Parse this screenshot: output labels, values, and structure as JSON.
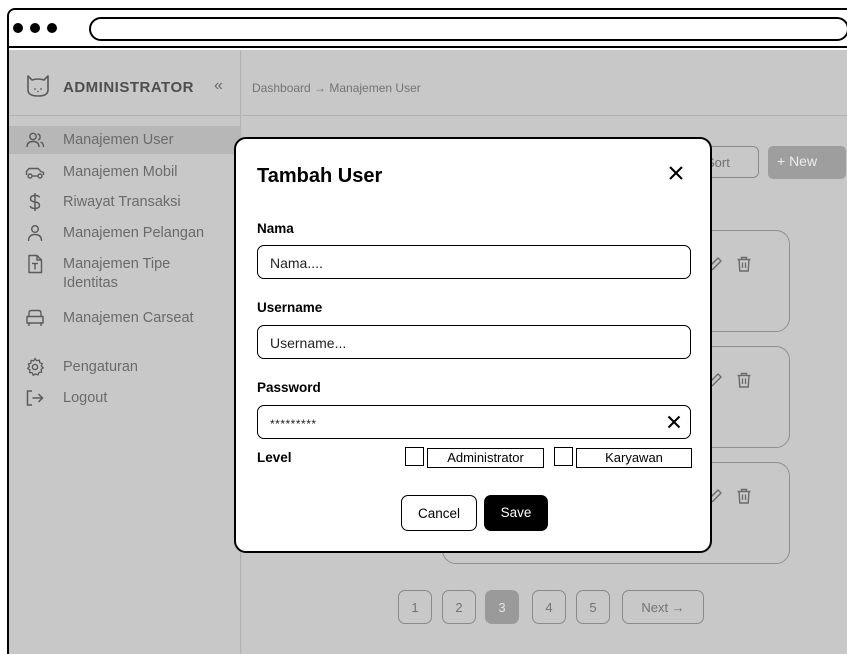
{
  "sidebar": {
    "brand_title": "ADMINISTRATOR",
    "collapse_glyph": "«",
    "logo_icon": "cat-face-icon",
    "items": [
      {
        "label": "Manajemen User",
        "icon": "users-icon",
        "active": true
      },
      {
        "label": "Manajemen Mobil",
        "icon": "car-icon",
        "active": false
      },
      {
        "label": "Riwayat Transaksi",
        "icon": "dollar-icon",
        "active": false
      },
      {
        "label": "Manajemen Pelangan",
        "icon": "user-icon",
        "active": false
      },
      {
        "label": "Manajemen Tipe Identitas",
        "icon": "id-file-icon",
        "active": false
      },
      {
        "label": "Manajemen Carseat",
        "icon": "car-seat-icon",
        "active": false
      },
      {
        "label": "Pengaturan",
        "icon": "gear-icon",
        "active": false
      },
      {
        "label": "Logout",
        "icon": "logout-icon",
        "active": false
      }
    ]
  },
  "header": {
    "breadcrumb": "Dashboard → Manajemen User"
  },
  "toolbar": {
    "sort_label": "Sort",
    "new_label": "+ New"
  },
  "pagination": {
    "pages": [
      "1",
      "2",
      "3",
      "4",
      "5"
    ],
    "current": "3",
    "next_label": "Next →"
  },
  "modal": {
    "title": "Tambah User",
    "fields": {
      "nama_label": "Nama",
      "nama_value": "Nama....",
      "username_label": "Username",
      "username_value": "Username...",
      "password_label": "Password",
      "password_value": "*********",
      "level_label": "Level"
    },
    "level_options": [
      "Administrator",
      "Karyawan"
    ],
    "cancel_label": "Cancel",
    "save_label": "Save"
  },
  "colors": {
    "overlay": "#c4c4c4",
    "modal_bg": "#ffffff",
    "primary_button": "#000000",
    "active_page": "#9a9a9a"
  }
}
